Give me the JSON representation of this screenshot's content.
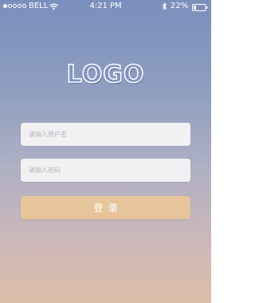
{
  "status_bar": {
    "carrier": "BELL",
    "time": "4:21 PM",
    "battery": "22%",
    "signal_bars_filled": 1,
    "signal_bars_total": 5,
    "battery_level": 0.22,
    "icons": [
      "wifi-icon",
      "bluetooth-icon",
      "battery-icon"
    ]
  },
  "logo": {
    "text": "LOGO"
  },
  "login_form": {
    "username_placeholder": "请输入用户名",
    "username_value": "",
    "password_placeholder": "请输入密码",
    "password_value": "",
    "login_label": "登录"
  },
  "colors": {
    "gradient_top": "#7b8fbd",
    "gradient_bottom": "#dcbda8",
    "button": "#e6c59b",
    "input_bg": "#f1f1f3"
  }
}
